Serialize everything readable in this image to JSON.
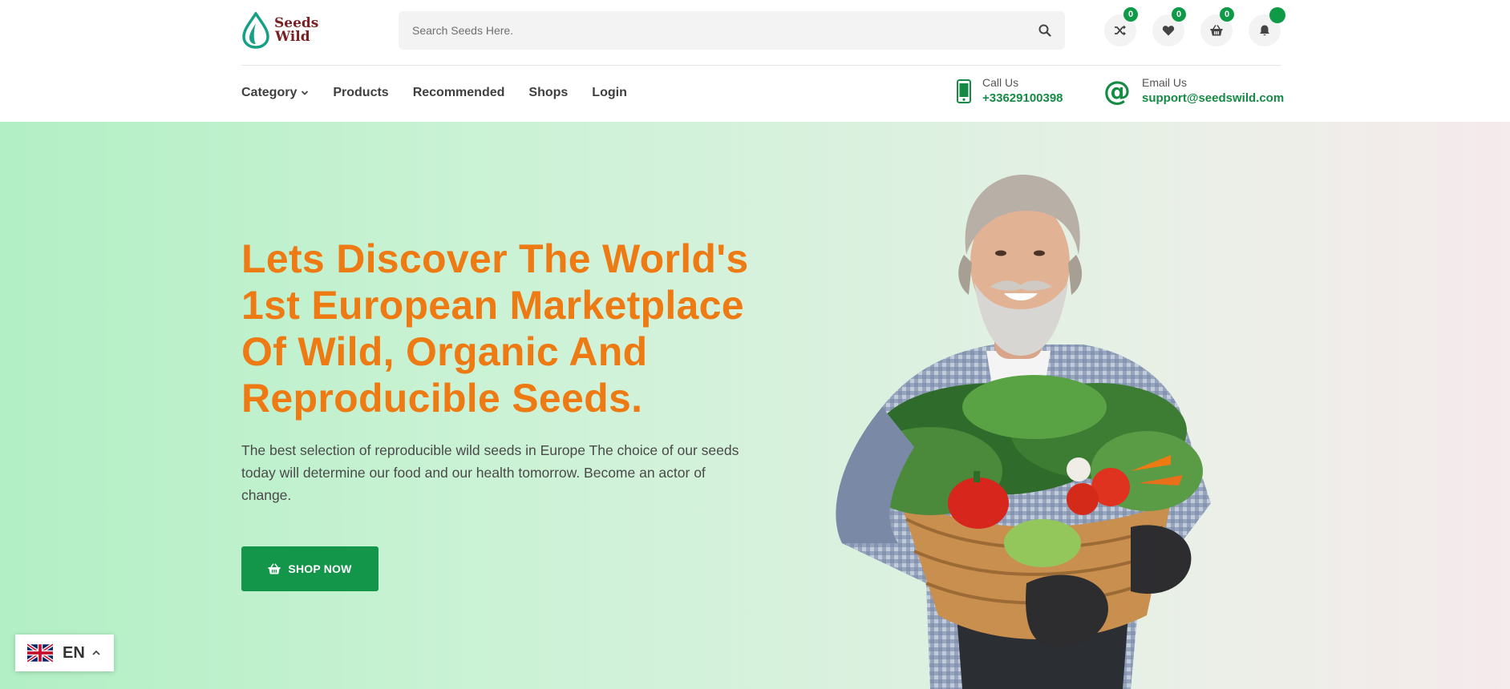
{
  "brand": {
    "name_line1": "Seeds",
    "name_line2": "Wild",
    "accent_color": "#158a45",
    "logo_color": "#7a1f23"
  },
  "search": {
    "placeholder": "Search Seeds Here.",
    "value": "",
    "icon": "search-icon"
  },
  "header_icons": [
    {
      "name": "compare",
      "icon": "shuffle-icon",
      "count": "0"
    },
    {
      "name": "wishlist",
      "icon": "heart-icon",
      "count": "0"
    },
    {
      "name": "cart",
      "icon": "basket-icon",
      "count": "0"
    },
    {
      "name": "notifications",
      "icon": "bell-icon",
      "count": ""
    }
  ],
  "nav": {
    "items": [
      {
        "label": "Category",
        "has_dropdown": true
      },
      {
        "label": "Products"
      },
      {
        "label": "Recommended"
      },
      {
        "label": "Shops"
      },
      {
        "label": "Login"
      }
    ]
  },
  "contact": {
    "call_label": "Call Us",
    "call_value": "+33629100398",
    "email_label": "Email Us",
    "email_value": "support@seedswild.com"
  },
  "hero": {
    "title": "Lets Discover The World's 1st European Marketplace Of Wild, Organic And Reproducible Seeds.",
    "description": "The best selection of reproducible wild seeds in Europe The choice of our seeds today will determine our food and our health tomorrow. Become an actor of change.",
    "button_label": "SHOP NOW",
    "title_color": "#ee7a14",
    "button_color": "#14964a"
  },
  "language": {
    "code": "EN",
    "flag": "uk-flag-icon"
  }
}
